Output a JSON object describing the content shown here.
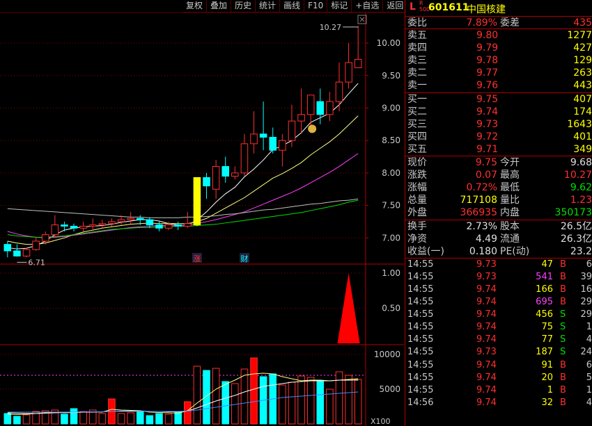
{
  "toolbar": [
    "复权",
    "叠加",
    "历史",
    "统计",
    "画线",
    "F10",
    "标记",
    "+自选",
    "返回"
  ],
  "stock": {
    "market": "L",
    "badge_top": "R",
    "badge_bottom": "500",
    "code": "601611",
    "name": "中国核建"
  },
  "book": {
    "weibi_label": "委比",
    "weibi": "7.89%",
    "weicha_label": "委差",
    "weicha": "435",
    "sells": [
      {
        "label": "卖五",
        "price": "9.80",
        "vol": "1277"
      },
      {
        "label": "卖四",
        "price": "9.79",
        "vol": "427"
      },
      {
        "label": "卖三",
        "price": "9.78",
        "vol": "129"
      },
      {
        "label": "卖二",
        "price": "9.77",
        "vol": "263"
      },
      {
        "label": "卖一",
        "price": "9.76",
        "vol": "443"
      }
    ],
    "buys": [
      {
        "label": "买一",
        "price": "9.75",
        "vol": "407"
      },
      {
        "label": "买二",
        "price": "9.74",
        "vol": "174"
      },
      {
        "label": "买三",
        "price": "9.73",
        "vol": "1643"
      },
      {
        "label": "买四",
        "price": "9.72",
        "vol": "401"
      },
      {
        "label": "买五",
        "price": "9.71",
        "vol": "349"
      }
    ]
  },
  "quote": [
    {
      "l1": "现价",
      "v1": "9.75",
      "c1": "red",
      "l2": "今开",
      "v2": "9.68",
      "c2": "wht"
    },
    {
      "l1": "涨跌",
      "v1": "0.07",
      "c1": "red",
      "l2": "最高",
      "v2": "10.27",
      "c2": "red"
    },
    {
      "l1": "涨幅",
      "v1": "0.72%",
      "c1": "red",
      "l2": "最低",
      "v2": "9.62",
      "c2": "grn"
    },
    {
      "l1": "总量",
      "v1": "717108",
      "c1": "yel",
      "l2": "量比",
      "v2": "1.23",
      "c2": "red"
    },
    {
      "l1": "外盘",
      "v1": "366935",
      "c1": "red",
      "l2": "内盘",
      "v2": "350173",
      "c2": "grn"
    }
  ],
  "fundamentals": [
    {
      "l1": "换手",
      "v1": "2.73%",
      "l2": "股本",
      "v2": "26.5亿"
    },
    {
      "l1": "净资",
      "v1": "4.49",
      "l2": "流通",
      "v2": "26.3亿"
    },
    {
      "l1": "收益(一)",
      "v1": "0.180",
      "l2": "PE(动)",
      "v2": "23.2"
    }
  ],
  "ticks": [
    {
      "time": "14:55",
      "price": "9.73",
      "vol": "47",
      "bs": "B",
      "n": "6",
      "vc": "yel",
      "bc": "red"
    },
    {
      "time": "14:55",
      "price": "9.73",
      "vol": "541",
      "bs": "B",
      "n": "39",
      "vc": "mag",
      "bc": "red"
    },
    {
      "time": "14:55",
      "price": "9.74",
      "vol": "166",
      "bs": "B",
      "n": "16",
      "vc": "yel",
      "bc": "red"
    },
    {
      "time": "14:55",
      "price": "9.74",
      "vol": "695",
      "bs": "B",
      "n": "29",
      "vc": "mag",
      "bc": "red"
    },
    {
      "time": "14:55",
      "price": "9.74",
      "vol": "456",
      "bs": "S",
      "n": "29",
      "vc": "yel",
      "bc": "grn"
    },
    {
      "time": "14:55",
      "price": "9.74",
      "vol": "75",
      "bs": "S",
      "n": "1",
      "vc": "yel",
      "bc": "grn"
    },
    {
      "time": "14:55",
      "price": "9.74",
      "vol": "77",
      "bs": "S",
      "n": "4",
      "vc": "yel",
      "bc": "grn"
    },
    {
      "time": "14:55",
      "price": "9.73",
      "vol": "187",
      "bs": "S",
      "n": "24",
      "vc": "yel",
      "bc": "grn"
    },
    {
      "time": "14:55",
      "price": "9.74",
      "vol": "91",
      "bs": "B",
      "n": "6",
      "vc": "yel",
      "bc": "red"
    },
    {
      "time": "14:55",
      "price": "9.74",
      "vol": "20",
      "bs": "B",
      "n": "5",
      "vc": "yel",
      "bc": "red"
    },
    {
      "time": "14:55",
      "price": "9.74",
      "vol": "1",
      "bs": "B",
      "n": "1",
      "vc": "yel",
      "bc": "red"
    },
    {
      "time": "14:56",
      "price": "9.74",
      "vol": "32",
      "bs": "B",
      "n": "4",
      "vc": "yel",
      "bc": "red"
    }
  ],
  "chart_data": [
    {
      "type": "candlestick",
      "yticks": [
        "10.00",
        "9.50",
        "9.00",
        "8.50",
        "8.00",
        "7.50",
        "7.00"
      ],
      "ylim": [
        6.65,
        10.45
      ],
      "high_label": "10.27",
      "low_label": "6.71",
      "markers": [
        "涨",
        "财"
      ],
      "candles": [
        [
          6.9,
          6.8,
          6.95,
          6.7
        ],
        [
          6.8,
          6.72,
          6.9,
          6.71
        ],
        [
          6.72,
          6.82,
          6.85,
          6.7
        ],
        [
          6.82,
          6.95,
          7.0,
          6.8
        ],
        [
          6.95,
          7.05,
          7.1,
          6.9
        ],
        [
          7.05,
          7.2,
          7.35,
          7.0
        ],
        [
          7.2,
          7.18,
          7.25,
          7.1
        ],
        [
          7.18,
          7.15,
          7.22,
          7.1
        ],
        [
          7.15,
          7.18,
          7.25,
          7.1
        ],
        [
          7.18,
          7.2,
          7.3,
          7.12
        ],
        [
          7.2,
          7.22,
          7.28,
          7.15
        ],
        [
          7.22,
          7.25,
          7.3,
          7.18
        ],
        [
          7.25,
          7.28,
          7.35,
          7.2
        ],
        [
          7.28,
          7.3,
          7.4,
          7.22
        ],
        [
          7.3,
          7.28,
          7.35,
          7.2
        ],
        [
          7.28,
          7.2,
          7.32,
          7.15
        ],
        [
          7.2,
          7.15,
          7.25,
          7.1
        ],
        [
          7.15,
          7.2,
          7.25,
          7.12
        ],
        [
          7.2,
          7.18,
          7.25,
          7.12
        ],
        [
          7.18,
          7.22,
          7.4,
          7.15
        ],
        [
          7.2,
          7.93,
          7.93,
          7.18
        ],
        [
          7.93,
          7.8,
          8.0,
          7.6
        ],
        [
          7.75,
          8.1,
          8.2,
          7.6
        ],
        [
          8.1,
          7.95,
          8.25,
          7.85
        ],
        [
          7.95,
          8.0,
          8.1,
          7.9
        ],
        [
          8.0,
          8.45,
          8.6,
          7.95
        ],
        [
          8.45,
          8.6,
          8.95,
          8.3
        ],
        [
          8.6,
          8.55,
          9.1,
          8.35
        ],
        [
          8.55,
          8.35,
          8.7,
          8.3
        ],
        [
          8.35,
          8.5,
          8.6,
          8.1
        ],
        [
          8.5,
          8.8,
          9.05,
          8.4
        ],
        [
          8.8,
          8.9,
          9.3,
          8.6
        ],
        [
          8.9,
          9.2,
          9.2,
          8.7
        ],
        [
          9.1,
          8.9,
          9.3,
          8.75
        ],
        [
          8.9,
          9.1,
          9.25,
          8.8
        ],
        [
          9.1,
          9.4,
          9.7,
          8.95
        ],
        [
          9.4,
          9.7,
          10.0,
          9.3
        ],
        [
          9.62,
          9.75,
          10.27,
          9.62
        ]
      ],
      "ma": [
        {
          "color": "#ffffff",
          "values": [
            6.85,
            6.83,
            6.84,
            6.88,
            6.95,
            7.05,
            7.12,
            7.15,
            7.17,
            7.18,
            7.19,
            7.21,
            7.24,
            7.26,
            7.28,
            7.28,
            7.26,
            7.22,
            7.2,
            7.19,
            7.28,
            7.4,
            7.55,
            7.68,
            7.78,
            7.94,
            8.06,
            8.2,
            8.36,
            8.42,
            8.5,
            8.62,
            8.78,
            8.85,
            8.92,
            9.05,
            9.22,
            9.38
          ]
        },
        {
          "color": "#ffff80",
          "values": [
            6.95,
            6.92,
            6.9,
            6.9,
            6.92,
            6.96,
            7.0,
            7.05,
            7.09,
            7.12,
            7.15,
            7.17,
            7.19,
            7.21,
            7.22,
            7.23,
            7.22,
            7.22,
            7.22,
            7.22,
            7.25,
            7.3,
            7.38,
            7.46,
            7.54,
            7.62,
            7.72,
            7.82,
            7.92,
            7.99,
            8.07,
            8.16,
            8.28,
            8.38,
            8.48,
            8.6,
            8.74,
            8.88
          ]
        },
        {
          "color": "#ff40ff",
          "values": [
            7.1,
            7.06,
            7.03,
            7.01,
            7.0,
            7.01,
            7.02,
            7.04,
            7.06,
            7.08,
            7.1,
            7.12,
            7.14,
            7.16,
            7.17,
            7.18,
            7.19,
            7.19,
            7.19,
            7.2,
            7.22,
            7.25,
            7.28,
            7.32,
            7.36,
            7.4,
            7.46,
            7.52,
            7.58,
            7.64,
            7.7,
            7.77,
            7.85,
            7.93,
            8.01,
            8.1,
            8.2,
            8.3
          ]
        },
        {
          "color": "#00e000",
          "values": [
            7.05,
            7.03,
            7.02,
            7.01,
            7.01,
            7.02,
            7.03,
            7.05,
            7.07,
            7.09,
            7.11,
            7.13,
            7.14,
            7.15,
            7.16,
            7.16,
            7.17,
            7.17,
            7.18,
            7.18,
            7.19,
            7.2,
            7.21,
            7.23,
            7.25,
            7.27,
            7.29,
            7.31,
            7.33,
            7.35,
            7.37,
            7.39,
            7.42,
            7.45,
            7.48,
            7.51,
            7.55,
            7.58
          ]
        },
        {
          "color": "#c0c0c0",
          "values": [
            7.45,
            7.44,
            7.43,
            7.42,
            7.41,
            7.4,
            7.39,
            7.38,
            7.37,
            7.36,
            7.35,
            7.34,
            7.33,
            7.32,
            7.32,
            7.31,
            7.31,
            7.31,
            7.31,
            7.32,
            7.32,
            7.33,
            7.34,
            7.36,
            7.37,
            7.39,
            7.41,
            7.43,
            7.44,
            7.46,
            7.48,
            7.5,
            7.52,
            7.53,
            7.55,
            7.57,
            7.58,
            7.6
          ]
        }
      ]
    },
    {
      "type": "area",
      "yticks": [
        "1.00",
        "0.50"
      ],
      "ylim": [
        0,
        1.05
      ],
      "signal": {
        "index": 36,
        "value": 1.0
      }
    },
    {
      "type": "bar",
      "yticks": [
        "10000",
        "5000"
      ],
      "unit": "X100",
      "ylim": [
        0,
        11000
      ],
      "values": [
        1500,
        1100,
        1300,
        1800,
        1900,
        2000,
        1400,
        2200,
        1800,
        2000,
        1500,
        3600,
        1500,
        1600,
        1800,
        1200,
        1500,
        1400,
        1700,
        3200,
        8300,
        7700,
        8000,
        6100,
        5800,
        7900,
        9500,
        6800,
        7200,
        5600,
        6000,
        6900,
        6700,
        6200,
        5000,
        7500,
        7000,
        6400
      ],
      "ma": [
        {
          "color": "#ffff80",
          "values": [
            1400,
            1350,
            1400,
            1500,
            1600,
            1700,
            1600,
            1650,
            1700,
            1750,
            1700,
            2100,
            2000,
            1950,
            1900,
            1700,
            1650,
            1600,
            1550,
            1900,
            3000,
            4000,
            5000,
            5700,
            6300,
            7000,
            7200,
            7300,
            7200,
            6800,
            6500,
            6200,
            6300,
            6300,
            6200,
            6300,
            6400,
            6500
          ]
        },
        {
          "color": "#ffffff",
          "values": [
            1600,
            1550,
            1500,
            1500,
            1550,
            1600,
            1650,
            1650,
            1700,
            1700,
            1750,
            1800,
            1850,
            1850,
            1850,
            1800,
            1800,
            1750,
            1750,
            1850,
            2300,
            2800,
            3300,
            3700,
            4100,
            4600,
            5000,
            5400,
            5600,
            5800,
            6000,
            6100,
            6200,
            6200,
            6200,
            6300,
            6300,
            6300
          ]
        },
        {
          "color": "#4488ff",
          "values": [
            1700,
            1700,
            1700,
            1700,
            1700,
            1700,
            1700,
            1700,
            1750,
            1750,
            1750,
            1800,
            1800,
            1800,
            1800,
            1800,
            1800,
            1800,
            1800,
            1850,
            2000,
            2200,
            2400,
            2600,
            2800,
            3000,
            3200,
            3400,
            3600,
            3800,
            3900,
            4000,
            4100,
            4200,
            4300,
            4400,
            4500,
            4600
          ]
        }
      ]
    }
  ]
}
